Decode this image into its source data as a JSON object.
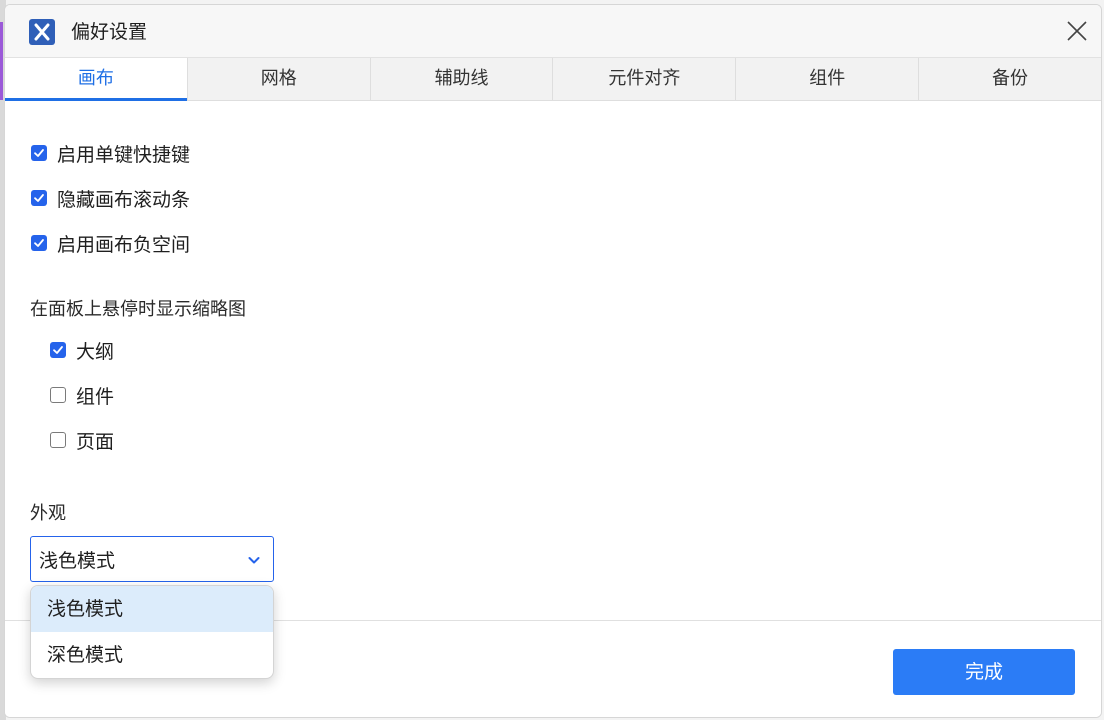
{
  "window": {
    "title": "偏好设置",
    "logo_icon": "x-logo-icon"
  },
  "tabs": [
    {
      "label": "画布",
      "active": true
    },
    {
      "label": "网格",
      "active": false
    },
    {
      "label": "辅助线",
      "active": false
    },
    {
      "label": "元件对齐",
      "active": false
    },
    {
      "label": "组件",
      "active": false
    },
    {
      "label": "备份",
      "active": false
    }
  ],
  "options": [
    {
      "label": "启用单键快捷键",
      "checked": true
    },
    {
      "label": "隐藏画布滚动条",
      "checked": true
    },
    {
      "label": "启用画布负空间",
      "checked": true
    }
  ],
  "thumbnail_section": {
    "label": "在面板上悬停时显示缩略图",
    "items": [
      {
        "label": "大纲",
        "checked": true
      },
      {
        "label": "组件",
        "checked": false
      },
      {
        "label": "页面",
        "checked": false
      }
    ]
  },
  "appearance": {
    "label": "外观",
    "selected": "浅色模式",
    "options": [
      "浅色模式",
      "深色模式"
    ]
  },
  "footer": {
    "done_label": "完成"
  },
  "colors": {
    "accent": "#1f6fe5",
    "checkbox": "#2563eb",
    "button": "#2b7cf6",
    "option_highlight": "#dcecfb"
  }
}
